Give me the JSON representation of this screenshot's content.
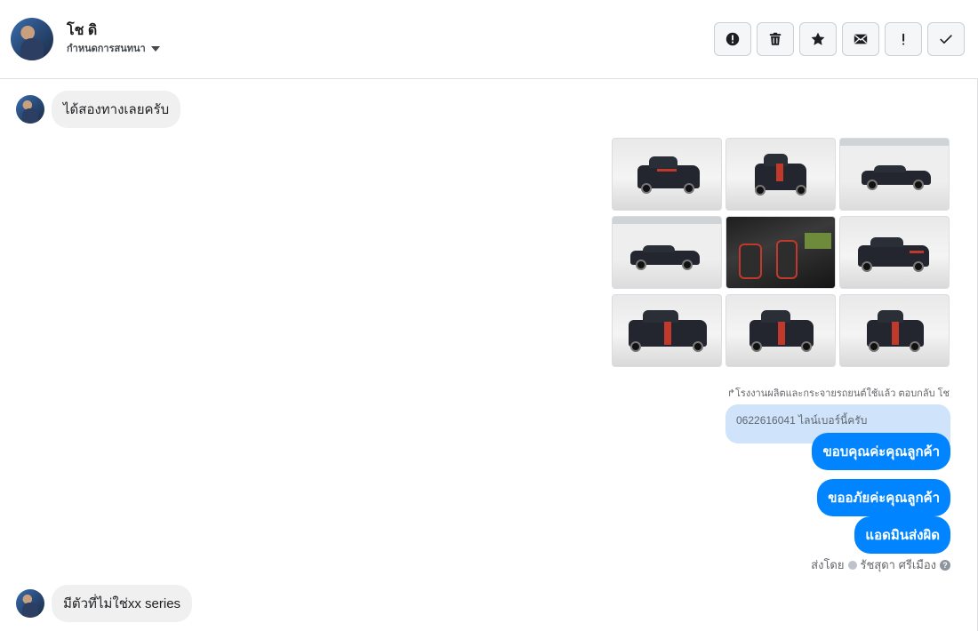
{
  "header": {
    "contact_name": "โช ดิ",
    "assign_label": "กำหนดการสนทนา",
    "actions": [
      {
        "name": "report-spam-button",
        "icon": "alert-circle-icon"
      },
      {
        "name": "delete-button",
        "icon": "trash-icon"
      },
      {
        "name": "star-button",
        "icon": "star-icon"
      },
      {
        "name": "mark-unread-button",
        "icon": "envelope-icon"
      },
      {
        "name": "follow-up-button",
        "icon": "exclamation-icon"
      },
      {
        "name": "mark-done-button",
        "icon": "check-icon"
      }
    ]
  },
  "messages": {
    "incoming_1": "ได้สองทางเลยครับ",
    "gallery_count": 9,
    "reply_note": "โรงงานผลิตและกระจายรถยนต์ใช้แล้ว ตอบกลับ โช",
    "quoted_text": "0622616041 ไลน์เบอร์นี้ครับ",
    "outgoing_1": "ขอบคุณค่ะคุณลูกค้า",
    "outgoing_2": "ขออภัยค่ะคุณลูกค้า",
    "outgoing_3": "แอดมินส่งผิด",
    "sent_by_prefix": "ส่งโดย",
    "sent_by_name": "รัชสุดา ศรีเมือง",
    "incoming_2": "มีตัวที่ไม่ใช่xx series"
  },
  "colors": {
    "accent": "#0084ff",
    "quoted_bg": "#cfe3fb",
    "incoming_bg": "#f0f0f0"
  }
}
